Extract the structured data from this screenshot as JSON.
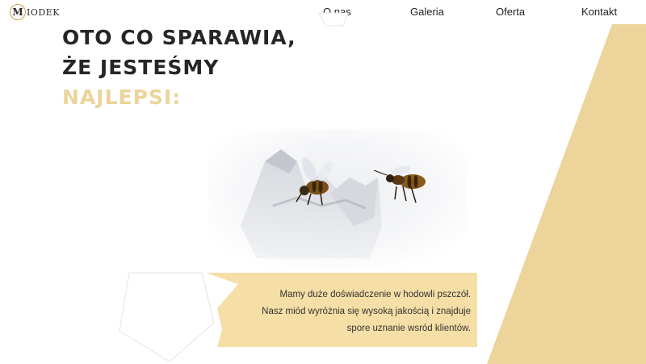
{
  "logo": {
    "letter": "M",
    "text": "IODEK"
  },
  "nav": {
    "items": [
      {
        "label": "O nas"
      },
      {
        "label": "Galeria"
      },
      {
        "label": "Oferta"
      },
      {
        "label": "Kontakt"
      }
    ]
  },
  "hero": {
    "line1": "OTO CO SPARAWIA,",
    "line2": "ŻE JESTEŚMY",
    "line3": "NAJLEPSI:"
  },
  "description": {
    "line1": "Mamy duże doświadczenie w hodowli pszczół.",
    "line2": "Nasz miód wyróżnia się wysoką jakością i znajduje",
    "line3": "spore uznanie wsród klientów."
  },
  "colors": {
    "accent": "#ecd49b",
    "box": "#f5dfa6",
    "heading": "#262626"
  }
}
